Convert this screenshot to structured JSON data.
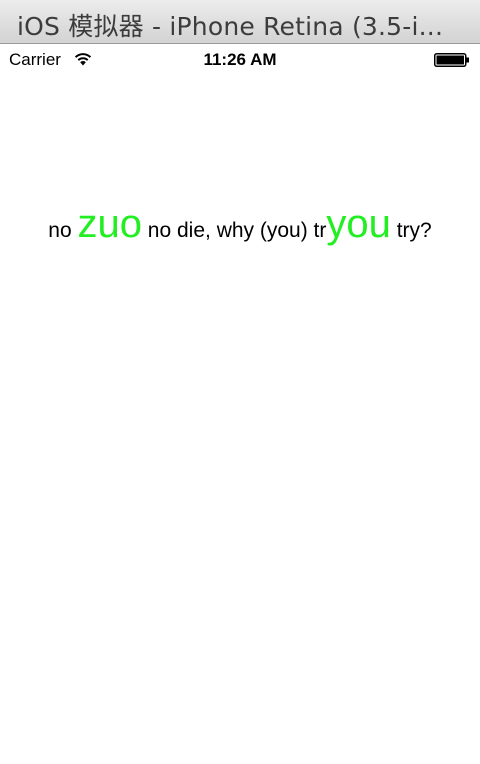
{
  "window": {
    "title": "iOS 模拟器 - iPhone Retina (3.5-i..."
  },
  "status_bar": {
    "carrier": "Carrier",
    "time": "11:26 AM",
    "wifi_icon": "wifi-icon",
    "battery_icon": "battery-icon"
  },
  "label": {
    "seg1": "no ",
    "seg2": "zuo",
    "seg3": " no die, why (you) tr",
    "seg4": "you",
    "seg5": " try?",
    "highlight_color": "#22ee22",
    "text_color": "#000000"
  }
}
